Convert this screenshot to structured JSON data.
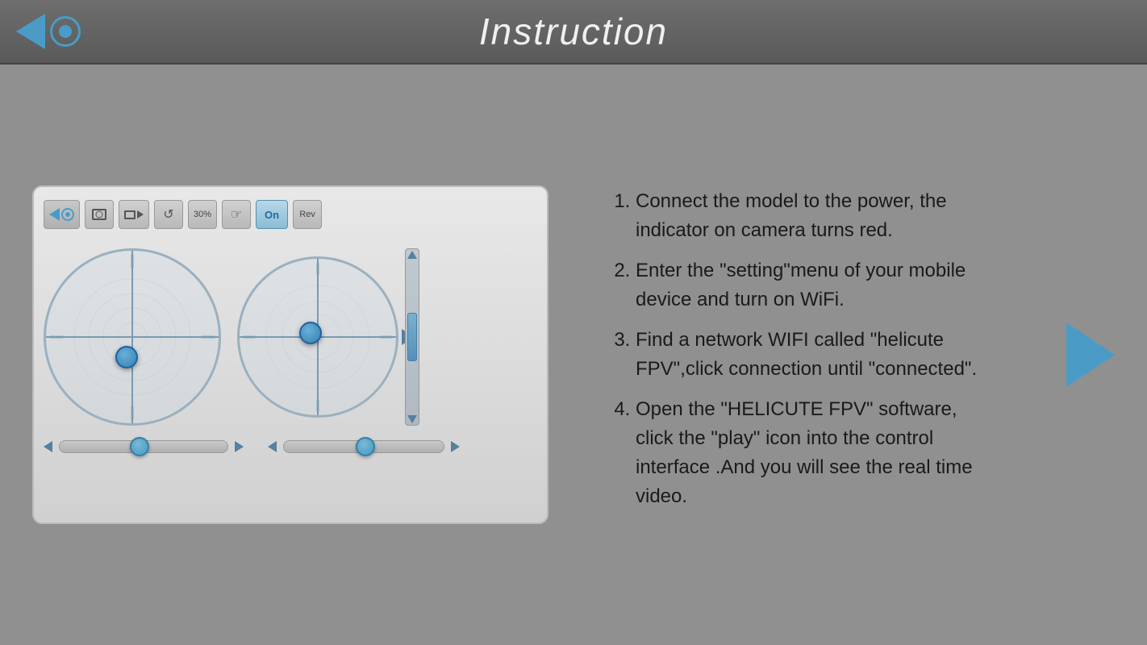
{
  "header": {
    "title": "Instruction"
  },
  "toolbar": {
    "logo_label": "",
    "photo_label": "",
    "video_label": "",
    "refresh_label": "",
    "percent_label": "30%",
    "touch_label": "",
    "on_label": "On",
    "rev_label": "Rev"
  },
  "instructions": {
    "step1": "Connect the model to the power, the indicator on camera turns red.",
    "step2": "Enter the \"setting\"menu of your mobile device and turn on WiFi.",
    "step3": "Find a network WIFI called \"helicute FPV\",click connection until \"connected\".",
    "step4": "Open the \"HELICUTE FPV\" software, click the \"play\" icon into the control interface .And you will see the real time video."
  }
}
